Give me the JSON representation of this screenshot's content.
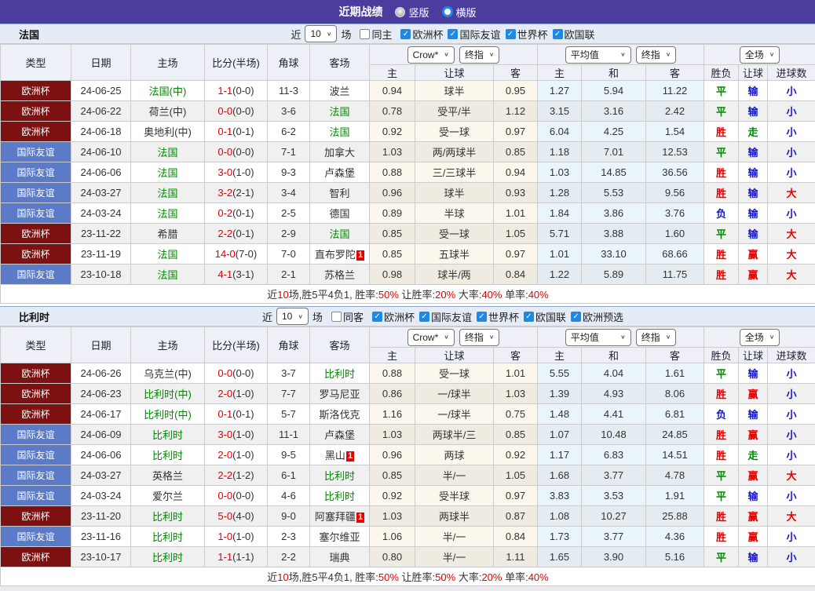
{
  "header": {
    "title": "近期战绩",
    "radio_vertical": "竖版",
    "radio_horizontal": "横版"
  },
  "controls": {
    "near": "近",
    "count": "10",
    "field": "场",
    "crow": "Crow*",
    "final": "终指",
    "avg": "平均值",
    "full": "全场"
  },
  "columns": {
    "type": "类型",
    "date": "日期",
    "home": "主场",
    "score": "比分(半场)",
    "corner": "角球",
    "away": "客场",
    "h": "主",
    "hcap": "让球",
    "a": "客",
    "avg_h": "主",
    "avg_d": "和",
    "avg_a": "客",
    "wdl": "胜负",
    "let_col": "让球",
    "goals": "进球数"
  },
  "colors": {
    "red": "#e60000",
    "green": "#008800",
    "blue": "#1515d0",
    "black": "#333333",
    "euro_bg": "#7d1010",
    "friendly_bg": "#5b7bc8",
    "accent": "#4a3d9e",
    "check_blue": "#1e88e5"
  },
  "tables": [
    {
      "title": "法国",
      "same_label": "同主",
      "leagues": [
        "欧洲杯",
        "国际友谊",
        "世界杯",
        "欧国联"
      ],
      "rows": [
        {
          "lg": "欧洲杯",
          "lc": "e",
          "date": "24-06-25",
          "home": {
            "t": "法国(中)",
            "g": 1
          },
          "score": "1-1",
          "half": "(0-0)",
          "corner": "11-3",
          "away": {
            "t": "波兰"
          },
          "o1": "0.94",
          "hc": "球半",
          "o2": "0.95",
          "a1": "1.27",
          "a2": "5.94",
          "a3": "11.22",
          "r": [
            [
              "平",
              "g"
            ],
            [
              "输",
              "b"
            ],
            [
              "小",
              "b"
            ]
          ]
        },
        {
          "lg": "欧洲杯",
          "lc": "e",
          "date": "24-06-22",
          "home": {
            "t": "荷兰(中)"
          },
          "score": "0-0",
          "half": "(0-0)",
          "corner": "3-6",
          "away": {
            "t": "法国",
            "g": 1
          },
          "o1": "0.78",
          "hc": "受平/半",
          "o2": "1.12",
          "a1": "3.15",
          "a2": "3.16",
          "a3": "2.42",
          "r": [
            [
              "平",
              "g"
            ],
            [
              "输",
              "b"
            ],
            [
              "小",
              "b"
            ]
          ]
        },
        {
          "lg": "欧洲杯",
          "lc": "e",
          "date": "24-06-18",
          "home": {
            "t": "奥地利(中)"
          },
          "score": "0-1",
          "half": "(0-1)",
          "corner": "6-2",
          "away": {
            "t": "法国",
            "g": 1
          },
          "o1": "0.92",
          "hc": "受一球",
          "o2": "0.97",
          "a1": "6.04",
          "a2": "4.25",
          "a3": "1.54",
          "r": [
            [
              "胜",
              "r"
            ],
            [
              "走",
              "g"
            ],
            [
              "小",
              "b"
            ]
          ]
        },
        {
          "lg": "国际友谊",
          "lc": "f",
          "date": "24-06-10",
          "home": {
            "t": "法国",
            "g": 1
          },
          "score": "0-0",
          "half": "(0-0)",
          "corner": "7-1",
          "away": {
            "t": "加拿大"
          },
          "o1": "1.03",
          "hc": "两/两球半",
          "o2": "0.85",
          "a1": "1.18",
          "a2": "7.01",
          "a3": "12.53",
          "r": [
            [
              "平",
              "g"
            ],
            [
              "输",
              "b"
            ],
            [
              "小",
              "b"
            ]
          ]
        },
        {
          "lg": "国际友谊",
          "lc": "f",
          "date": "24-06-06",
          "home": {
            "t": "法国",
            "g": 1
          },
          "score": "3-0",
          "half": "(1-0)",
          "corner": "9-3",
          "away": {
            "t": "卢森堡"
          },
          "o1": "0.88",
          "hc": "三/三球半",
          "o2": "0.94",
          "a1": "1.03",
          "a2": "14.85",
          "a3": "36.56",
          "r": [
            [
              "胜",
              "r"
            ],
            [
              "输",
              "b"
            ],
            [
              "小",
              "b"
            ]
          ]
        },
        {
          "lg": "国际友谊",
          "lc": "f",
          "date": "24-03-27",
          "home": {
            "t": "法国",
            "g": 1
          },
          "score": "3-2",
          "half": "(2-1)",
          "corner": "3-4",
          "away": {
            "t": "智利"
          },
          "o1": "0.96",
          "hc": "球半",
          "o2": "0.93",
          "a1": "1.28",
          "a2": "5.53",
          "a3": "9.56",
          "r": [
            [
              "胜",
              "r"
            ],
            [
              "输",
              "b"
            ],
            [
              "大",
              "r"
            ]
          ]
        },
        {
          "lg": "国际友谊",
          "lc": "f",
          "date": "24-03-24",
          "home": {
            "t": "法国",
            "g": 1
          },
          "score": "0-2",
          "half": "(0-1)",
          "corner": "2-5",
          "away": {
            "t": "德国"
          },
          "o1": "0.89",
          "hc": "半球",
          "o2": "1.01",
          "a1": "1.84",
          "a2": "3.86",
          "a3": "3.76",
          "r": [
            [
              "负",
              "b"
            ],
            [
              "输",
              "b"
            ],
            [
              "小",
              "b"
            ]
          ]
        },
        {
          "lg": "欧洲杯",
          "lc": "e",
          "date": "23-11-22",
          "home": {
            "t": "希腊"
          },
          "score": "2-2",
          "half": "(0-1)",
          "corner": "2-9",
          "away": {
            "t": "法国",
            "g": 1
          },
          "o1": "0.85",
          "hc": "受一球",
          "o2": "1.05",
          "a1": "5.71",
          "a2": "3.88",
          "a3": "1.60",
          "r": [
            [
              "平",
              "g"
            ],
            [
              "输",
              "b"
            ],
            [
              "大",
              "r"
            ]
          ]
        },
        {
          "lg": "欧洲杯",
          "lc": "e",
          "date": "23-11-19",
          "home": {
            "t": "法国",
            "g": 1
          },
          "score": "14-0",
          "half": "(7-0)",
          "corner": "7-0",
          "away": {
            "t": "直布罗陀",
            "badge": "1"
          },
          "o1": "0.85",
          "hc": "五球半",
          "o2": "0.97",
          "a1": "1.01",
          "a2": "33.10",
          "a3": "68.66",
          "r": [
            [
              "胜",
              "r"
            ],
            [
              "赢",
              "r"
            ],
            [
              "大",
              "r"
            ]
          ]
        },
        {
          "lg": "国际友谊",
          "lc": "f",
          "date": "23-10-18",
          "home": {
            "t": "法国",
            "g": 1
          },
          "score": "4-1",
          "half": "(3-1)",
          "corner": "2-1",
          "away": {
            "t": "苏格兰"
          },
          "o1": "0.98",
          "hc": "球半/两",
          "o2": "0.84",
          "a1": "1.22",
          "a2": "5.89",
          "a3": "11.75",
          "r": [
            [
              "胜",
              "r"
            ],
            [
              "赢",
              "r"
            ],
            [
              "大",
              "r"
            ]
          ]
        }
      ],
      "summary": [
        [
          "近",
          "k"
        ],
        [
          "10",
          "r"
        ],
        [
          "场,胜5平4负1, 胜率:",
          "k"
        ],
        [
          "50%",
          "r"
        ],
        [
          " 让胜率:",
          "k"
        ],
        [
          "20%",
          "r"
        ],
        [
          " 大率:",
          "k"
        ],
        [
          "40%",
          "r"
        ],
        [
          " 单率:",
          "k"
        ],
        [
          "40%",
          "r"
        ]
      ]
    },
    {
      "title": "比利时",
      "same_label": "同客",
      "leagues": [
        "欧洲杯",
        "国际友谊",
        "世界杯",
        "欧国联",
        "欧洲预选"
      ],
      "rows": [
        {
          "lg": "欧洲杯",
          "lc": "e",
          "date": "24-06-26",
          "home": {
            "t": "乌克兰(中)"
          },
          "score": "0-0",
          "half": "(0-0)",
          "corner": "3-7",
          "away": {
            "t": "比利时",
            "g": 1
          },
          "o1": "0.88",
          "hc": "受一球",
          "o2": "1.01",
          "a1": "5.55",
          "a2": "4.04",
          "a3": "1.61",
          "r": [
            [
              "平",
              "g"
            ],
            [
              "输",
              "b"
            ],
            [
              "小",
              "b"
            ]
          ]
        },
        {
          "lg": "欧洲杯",
          "lc": "e",
          "date": "24-06-23",
          "home": {
            "t": "比利时(中)",
            "g": 1
          },
          "score": "2-0",
          "half": "(1-0)",
          "corner": "7-7",
          "away": {
            "t": "罗马尼亚"
          },
          "o1": "0.86",
          "hc": "一/球半",
          "o2": "1.03",
          "a1": "1.39",
          "a2": "4.93",
          "a3": "8.06",
          "r": [
            [
              "胜",
              "r"
            ],
            [
              "赢",
              "r"
            ],
            [
              "小",
              "b"
            ]
          ]
        },
        {
          "lg": "欧洲杯",
          "lc": "e",
          "date": "24-06-17",
          "home": {
            "t": "比利时(中)",
            "g": 1
          },
          "score": "0-1",
          "half": "(0-1)",
          "corner": "5-7",
          "away": {
            "t": "斯洛伐克"
          },
          "o1": "1.16",
          "hc": "一/球半",
          "o2": "0.75",
          "a1": "1.48",
          "a2": "4.41",
          "a3": "6.81",
          "r": [
            [
              "负",
              "b"
            ],
            [
              "输",
              "b"
            ],
            [
              "小",
              "b"
            ]
          ]
        },
        {
          "lg": "国际友谊",
          "lc": "f",
          "date": "24-06-09",
          "home": {
            "t": "比利时",
            "g": 1
          },
          "score": "3-0",
          "half": "(1-0)",
          "corner": "11-1",
          "away": {
            "t": "卢森堡"
          },
          "o1": "1.03",
          "hc": "两球半/三",
          "o2": "0.85",
          "a1": "1.07",
          "a2": "10.48",
          "a3": "24.85",
          "r": [
            [
              "胜",
              "r"
            ],
            [
              "赢",
              "r"
            ],
            [
              "小",
              "b"
            ]
          ]
        },
        {
          "lg": "国际友谊",
          "lc": "f",
          "date": "24-06-06",
          "home": {
            "t": "比利时",
            "g": 1
          },
          "score": "2-0",
          "half": "(1-0)",
          "corner": "9-5",
          "away": {
            "t": "黑山",
            "badge": "1"
          },
          "o1": "0.96",
          "hc": "两球",
          "o2": "0.92",
          "a1": "1.17",
          "a2": "6.83",
          "a3": "14.51",
          "r": [
            [
              "胜",
              "r"
            ],
            [
              "走",
              "g"
            ],
            [
              "小",
              "b"
            ]
          ]
        },
        {
          "lg": "国际友谊",
          "lc": "f",
          "date": "24-03-27",
          "home": {
            "t": "英格兰"
          },
          "score": "2-2",
          "half": "(1-2)",
          "corner": "6-1",
          "away": {
            "t": "比利时",
            "g": 1
          },
          "o1": "0.85",
          "hc": "半/一",
          "o2": "1.05",
          "a1": "1.68",
          "a2": "3.77",
          "a3": "4.78",
          "r": [
            [
              "平",
              "g"
            ],
            [
              "赢",
              "r"
            ],
            [
              "大",
              "r"
            ]
          ]
        },
        {
          "lg": "国际友谊",
          "lc": "f",
          "date": "24-03-24",
          "home": {
            "t": "爱尔兰"
          },
          "score": "0-0",
          "half": "(0-0)",
          "corner": "4-6",
          "away": {
            "t": "比利时",
            "g": 1
          },
          "o1": "0.92",
          "hc": "受半球",
          "o2": "0.97",
          "a1": "3.83",
          "a2": "3.53",
          "a3": "1.91",
          "r": [
            [
              "平",
              "g"
            ],
            [
              "输",
              "b"
            ],
            [
              "小",
              "b"
            ]
          ]
        },
        {
          "lg": "欧洲杯",
          "lc": "e",
          "date": "23-11-20",
          "home": {
            "t": "比利时",
            "g": 1
          },
          "score": "5-0",
          "half": "(4-0)",
          "corner": "9-0",
          "away": {
            "t": "阿塞拜疆",
            "badge": "1"
          },
          "o1": "1.03",
          "hc": "两球半",
          "o2": "0.87",
          "a1": "1.08",
          "a2": "10.27",
          "a3": "25.88",
          "r": [
            [
              "胜",
              "r"
            ],
            [
              "赢",
              "r"
            ],
            [
              "大",
              "r"
            ]
          ]
        },
        {
          "lg": "国际友谊",
          "lc": "f",
          "date": "23-11-16",
          "home": {
            "t": "比利时",
            "g": 1
          },
          "score": "1-0",
          "half": "(1-0)",
          "corner": "2-3",
          "away": {
            "t": "塞尔维亚"
          },
          "o1": "1.06",
          "hc": "半/一",
          "o2": "0.84",
          "a1": "1.73",
          "a2": "3.77",
          "a3": "4.36",
          "r": [
            [
              "胜",
              "r"
            ],
            [
              "赢",
              "r"
            ],
            [
              "小",
              "b"
            ]
          ]
        },
        {
          "lg": "欧洲杯",
          "lc": "e",
          "date": "23-10-17",
          "home": {
            "t": "比利时",
            "g": 1
          },
          "score": "1-1",
          "half": "(1-1)",
          "corner": "2-2",
          "away": {
            "t": "瑞典"
          },
          "o1": "0.80",
          "hc": "半/一",
          "o2": "1.11",
          "a1": "1.65",
          "a2": "3.90",
          "a3": "5.16",
          "r": [
            [
              "平",
              "g"
            ],
            [
              "输",
              "b"
            ],
            [
              "小",
              "b"
            ]
          ]
        }
      ],
      "summary": [
        [
          "近",
          "k"
        ],
        [
          "10",
          "r"
        ],
        [
          "场,胜5平4负1, 胜率:",
          "k"
        ],
        [
          "50%",
          "r"
        ],
        [
          " 让胜率:",
          "k"
        ],
        [
          "50%",
          "r"
        ],
        [
          " 大率:",
          "k"
        ],
        [
          "20%",
          "r"
        ],
        [
          " 单率:",
          "k"
        ],
        [
          "40%",
          "r"
        ]
      ]
    }
  ]
}
